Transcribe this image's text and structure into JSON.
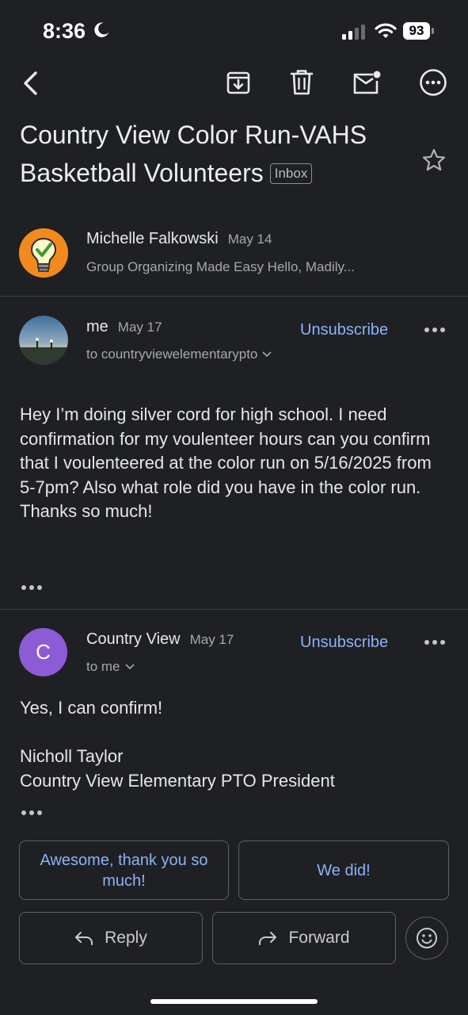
{
  "status_bar": {
    "time": "8:36",
    "battery": "93"
  },
  "toolbar": {
    "icons": [
      "back-icon",
      "archive-icon",
      "trash-icon",
      "mark-unread-icon",
      "more-icon"
    ]
  },
  "email": {
    "subject": "Country View Color Run-VAHS Basketball Volunteers",
    "label": "Inbox"
  },
  "messages": [
    {
      "sender": "Michelle Falkowski",
      "date": "May 14",
      "snippet": "Group Organizing Made Easy Hello, Madily..."
    },
    {
      "sender": "me",
      "date": "May 17",
      "recipient": "to countryviewelementarypto",
      "unsubscribe": "Unsubscribe",
      "body": "Hey I’m doing silver cord for high school. I need confirmation for my voulenteer hours can you confirm that I voulenteered at the color run on 5/16/2025 from 5-7pm? Also what role did you have in the color run. Thanks so much!"
    },
    {
      "sender": "Country View",
      "avatar_letter": "C",
      "date": "May 17",
      "recipient": "to me",
      "unsubscribe": "Unsubscribe",
      "body_line1": "Yes, I can confirm!",
      "body_line2": "Nicholl Taylor",
      "body_line3": "Country View Elementary PTO President"
    }
  ],
  "smart_replies": [
    "Awesome, thank you so much!",
    "We did!"
  ],
  "actions": {
    "reply": "Reply",
    "forward": "Forward"
  },
  "colors": {
    "background": "#1f2024",
    "accent": "#8ab4f8",
    "avatar_c": "#8e5bd6"
  }
}
